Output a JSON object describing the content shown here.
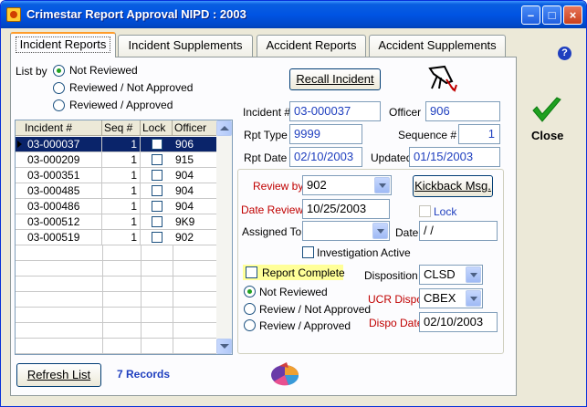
{
  "window": {
    "title": "Crimestar Report Approval  NIPD : 2003"
  },
  "tabs": [
    {
      "label": "Incident Reports"
    },
    {
      "label": "Incident Supplements"
    },
    {
      "label": "Accident Reports"
    },
    {
      "label": "Accident Supplements"
    }
  ],
  "list_by": {
    "label": "List by",
    "options": [
      "Not Reviewed",
      "Reviewed / Not Approved",
      "Reviewed / Approved"
    ],
    "selected": "Not Reviewed"
  },
  "grid": {
    "columns": [
      "Incident #",
      "Seq #",
      "Lock",
      "Officer"
    ],
    "rows": [
      {
        "incident": "03-000037",
        "seq": "1",
        "officer": "906"
      },
      {
        "incident": "03-000209",
        "seq": "1",
        "officer": "915"
      },
      {
        "incident": "03-000351",
        "seq": "1",
        "officer": "904"
      },
      {
        "incident": "03-000485",
        "seq": "1",
        "officer": "904"
      },
      {
        "incident": "03-000486",
        "seq": "1",
        "officer": "904"
      },
      {
        "incident": "03-000512",
        "seq": "1",
        "officer": "9K9"
      },
      {
        "incident": "03-000519",
        "seq": "1",
        "officer": "902"
      }
    ]
  },
  "buttons": {
    "recall": "Recall Incident",
    "kickback": "Kickback Msg.",
    "refresh": "Refresh List",
    "close": "Close"
  },
  "records": "7 Records",
  "details": {
    "incident_label": "Incident #",
    "incident": "03-000037",
    "officer_label": "Officer",
    "officer": "906",
    "rpt_type_label": "Rpt Type",
    "rpt_type": "9999",
    "sequence_label": "Sequence #",
    "sequence": "1",
    "rpt_date_label": "Rpt Date",
    "rpt_date": "02/10/2003",
    "updated_label": "Updated",
    "updated": "01/15/2003"
  },
  "review": {
    "review_by_label": "Review by",
    "review_by": "902",
    "date_review_label": "Date Review",
    "date_review": "10/25/2003",
    "lock_label": "Lock",
    "assigned_to_label": "Assigned To",
    "assigned_to": "",
    "date_label": "Date",
    "date": " / /",
    "investigation_label": "Investigation Active",
    "report_complete_label": "Report Complete",
    "status_options": [
      "Not Reviewed",
      "Review / Not Approved",
      "Review / Approved"
    ],
    "status_selected": "Not Reviewed",
    "disposition_label": "Disposition :",
    "disposition": "CLSD",
    "ucr_dispo_label": "UCR Dispo",
    "ucr_dispo": "CBEX",
    "dispo_date_label": "Dispo Date",
    "dispo_date": "02/10/2003"
  },
  "colors": {
    "title_bar": "#0054e3",
    "selected_row": "#0a246a",
    "accent_red": "#c00000",
    "value_blue": "#1f3fbf",
    "highlight_yellow": "#ffff99"
  }
}
